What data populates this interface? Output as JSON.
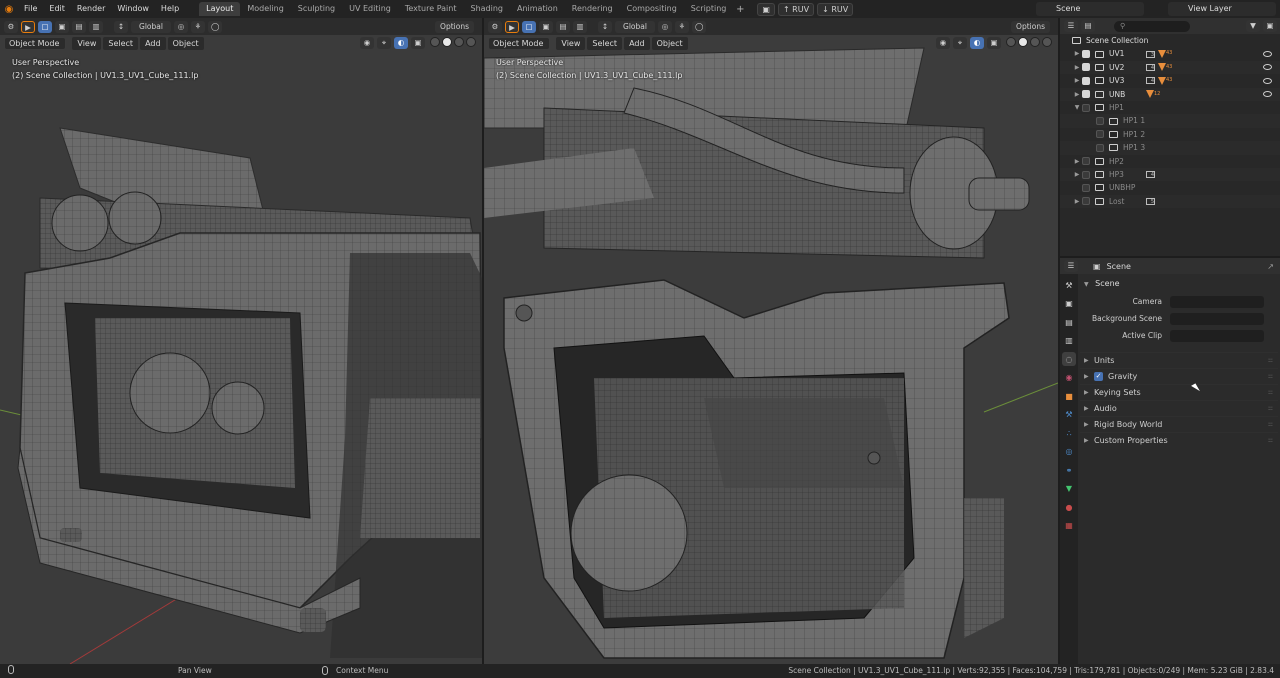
{
  "topbar": {
    "menus": [
      "File",
      "Edit",
      "Render",
      "Window",
      "Help"
    ],
    "workspaces": [
      "Layout",
      "Modeling",
      "Sculpting",
      "UV Editing",
      "Texture Paint",
      "Shading",
      "Animation",
      "Rendering",
      "Compositing",
      "Scripting"
    ],
    "active_workspace": "Layout",
    "ruv_up": "↑ RUV",
    "ruv_down": "↓ RUV",
    "scene_name": "Scene",
    "view_layer": "View Layer"
  },
  "viewport_left": {
    "transform_orientation": "Global",
    "options": "Options",
    "mode": "Object Mode",
    "menus": [
      "View",
      "Select",
      "Add",
      "Object"
    ],
    "perspective": "User Perspective",
    "info": "(2) Scene Collection | UV1.3_UV1_Cube_111.lp"
  },
  "viewport_right": {
    "transform_orientation": "Global",
    "options": "Options",
    "mode": "Object Mode",
    "menus": [
      "View",
      "Select",
      "Add",
      "Object"
    ],
    "perspective": "User Perspective",
    "info": "(2) Scene Collection | UV1.3_UV1_Cube_111.lp"
  },
  "outliner": {
    "root": "Scene Collection",
    "rows": [
      {
        "label": "UV1",
        "checked": true,
        "dim": false,
        "badge": "3",
        "tri": "43"
      },
      {
        "label": "UV2",
        "checked": true,
        "dim": false,
        "badge": "4",
        "tri": "43"
      },
      {
        "label": "UV3",
        "checked": true,
        "dim": false,
        "badge": "4",
        "tri": "43"
      },
      {
        "label": "UNB",
        "checked": true,
        "dim": false,
        "badge": "",
        "tri": "12"
      },
      {
        "label": "HP1",
        "checked": false,
        "dim": true,
        "badge": "",
        "tri": ""
      },
      {
        "label": "HP1 1",
        "checked": false,
        "dim": true,
        "badge": "",
        "tri": ""
      },
      {
        "label": "HP1 2",
        "checked": false,
        "dim": true,
        "badge": "",
        "tri": ""
      },
      {
        "label": "HP1 3",
        "checked": false,
        "dim": true,
        "badge": "",
        "tri": ""
      },
      {
        "label": "HP2",
        "checked": false,
        "dim": true,
        "badge": "",
        "tri": ""
      },
      {
        "label": "HP3",
        "checked": false,
        "dim": true,
        "badge": "4",
        "tri": ""
      },
      {
        "label": "UNBHP",
        "checked": false,
        "dim": true,
        "badge": "",
        "tri": ""
      },
      {
        "label": "Lost",
        "checked": false,
        "dim": true,
        "badge": "5",
        "tri": ""
      }
    ]
  },
  "properties": {
    "context": "Scene",
    "panel": "Scene",
    "fields": [
      {
        "label": "Camera",
        "value": ""
      },
      {
        "label": "Background Scene",
        "value": ""
      },
      {
        "label": "Active Clip",
        "value": ""
      }
    ],
    "subpanels": [
      "Units",
      "Gravity",
      "Keying Sets",
      "Audio",
      "Rigid Body World",
      "Custom Properties"
    ]
  },
  "statusbar": {
    "left_hint": "Pan View",
    "mid_hint": "Context Menu",
    "stats": "Scene Collection | UV1.3_UV1_Cube_111.lp | Verts:92,355 | Faces:104,759 | Tris:179,781 | Objects:0/249 | Mem: 5.23 GiB | 2.83.4"
  },
  "colors": {
    "accent": "#4772b3",
    "orange": "#e87d0d",
    "viewport_bg": "#3a3a3a"
  }
}
